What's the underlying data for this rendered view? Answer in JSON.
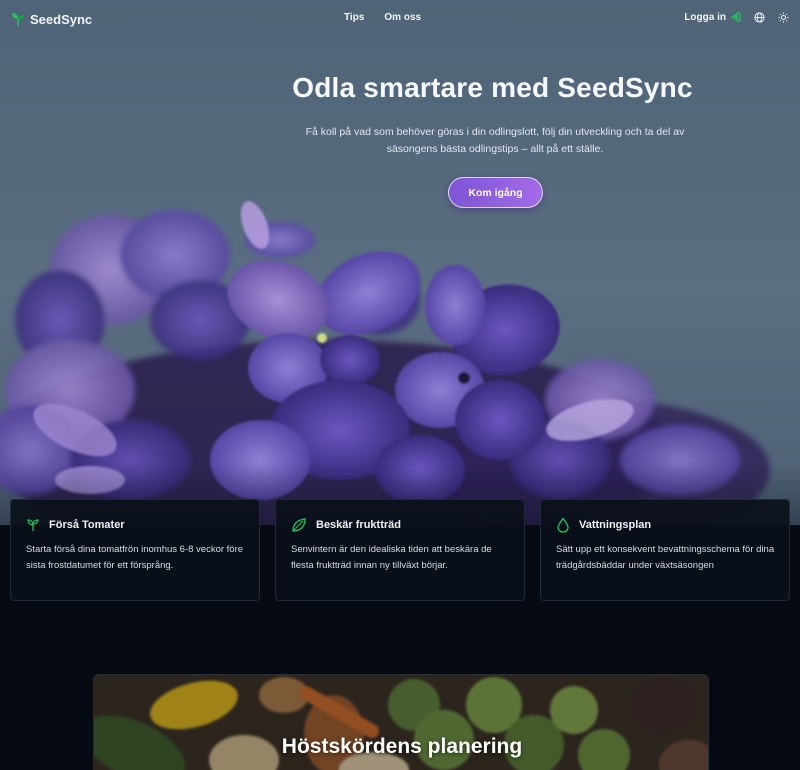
{
  "brand": {
    "name": "SeedSync",
    "accent": "#22c55e"
  },
  "nav": {
    "links": [
      "Tips",
      "Om oss"
    ],
    "login_label": "Logga in"
  },
  "hero": {
    "title": "Odla smartare med SeedSync",
    "subtitle": "Få koll på vad som behöver göras i din odlingslott, följ din utveckling och ta del av säsongens bästa odlingstips – allt på ett ställe.",
    "cta_label": "Kom igång",
    "cta_color": "#8b5cf6"
  },
  "cards": [
    {
      "icon": "sprout-icon",
      "title": "Förså Tomater",
      "text": "Starta förså dina tomatfrön inomhus 6-8 veckor före sista frostdatumet för ett försprång."
    },
    {
      "icon": "leaf-icon",
      "title": "Beskär fruktträd",
      "text": "Senvintern är den idealiska tiden att beskära de flesta fruktträd innan ny tillväxt börjar."
    },
    {
      "icon": "droplet-icon",
      "title": "Vattningsplan",
      "text": "Sätt upp ett konsekvent bevattningsschema för dina trädgårdsbäddar under växtsäsongen"
    }
  ],
  "section": {
    "title": "Höstskördens planering"
  }
}
